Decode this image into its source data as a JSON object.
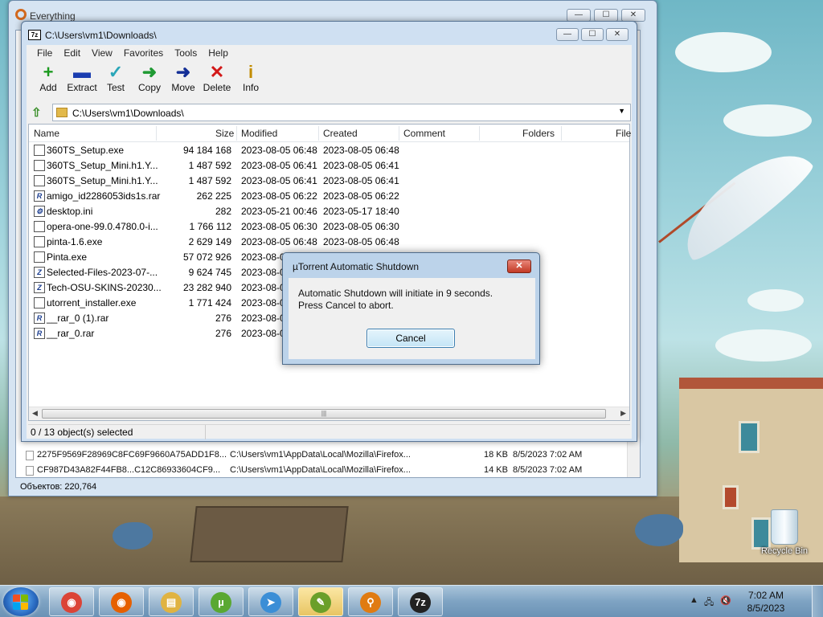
{
  "desktop": {
    "recycle_bin_label": "Recycle Bin"
  },
  "everything": {
    "title": "Everything",
    "controls": [
      "—",
      "☐",
      "✕"
    ],
    "rows": [
      {
        "name": "2275F9569F28969C8FC69F9660A75ADD1F8...",
        "path": "C:\\Users\\vm1\\AppData\\Local\\Mozilla\\Firefox...",
        "size": "18 KB",
        "date": "8/5/2023 7:02 AM"
      },
      {
        "name": "CF987D43A82F44FB8...C12C86933604CF9...",
        "path": "C:\\Users\\vm1\\AppData\\Local\\Mozilla\\Firefox...",
        "size": "14 KB",
        "date": "8/5/2023 7:02 AM"
      }
    ],
    "status": "Объектов: 220,764"
  },
  "sevenzip": {
    "title": "C:\\Users\\vm1\\Downloads\\",
    "controls": [
      "—",
      "☐",
      "✕"
    ],
    "menu": [
      "File",
      "Edit",
      "View",
      "Favorites",
      "Tools",
      "Help"
    ],
    "toolbar": [
      {
        "label": "Add",
        "glyph": "+",
        "color": "#1c9a20",
        "name": "add-button"
      },
      {
        "label": "Extract",
        "glyph": "▬",
        "color": "#1a3db0",
        "name": "extract-button"
      },
      {
        "label": "Test",
        "glyph": "✓",
        "color": "#2aa6b8",
        "name": "test-button"
      },
      {
        "label": "Copy",
        "glyph": "➜",
        "color": "#1f9a33",
        "name": "copy-button"
      },
      {
        "label": "Move",
        "glyph": "➜",
        "color": "#132e96",
        "name": "move-button"
      },
      {
        "label": "Delete",
        "glyph": "✕",
        "color": "#d21818",
        "name": "delete-button"
      },
      {
        "label": "Info",
        "glyph": "i",
        "color": "#c28c00",
        "name": "info-button"
      }
    ],
    "address": "C:\\Users\\vm1\\Downloads\\",
    "columns": [
      "Name",
      "Size",
      "Modified",
      "Created",
      "Comment",
      "Folders",
      "File"
    ],
    "files": [
      {
        "name": "360TS_Setup.exe",
        "size": "94 184 168",
        "modified": "2023-08-05 06:48",
        "created": "2023-08-05 06:48",
        "icon": ""
      },
      {
        "name": "360TS_Setup_Mini.h1.Y...",
        "size": "1 487 592",
        "modified": "2023-08-05 06:41",
        "created": "2023-08-05 06:41",
        "icon": ""
      },
      {
        "name": "360TS_Setup_Mini.h1.Y...",
        "size": "1 487 592",
        "modified": "2023-08-05 06:41",
        "created": "2023-08-05 06:41",
        "icon": ""
      },
      {
        "name": "amigo_id2286053ids1s.rar",
        "size": "262 225",
        "modified": "2023-08-05 06:22",
        "created": "2023-08-05 06:22",
        "icon": "R"
      },
      {
        "name": "desktop.ini",
        "size": "282",
        "modified": "2023-05-21 00:46",
        "created": "2023-05-17 18:40",
        "icon": "⚙"
      },
      {
        "name": "opera-one-99.0.4780.0-i...",
        "size": "1 766 112",
        "modified": "2023-08-05 06:30",
        "created": "2023-08-05 06:30",
        "icon": ""
      },
      {
        "name": "pinta-1.6.exe",
        "size": "2 629 149",
        "modified": "2023-08-05 06:48",
        "created": "2023-08-05 06:48",
        "icon": ""
      },
      {
        "name": "Pinta.exe",
        "size": "57 072 926",
        "modified": "2023-08-0",
        "created": "",
        "icon": ""
      },
      {
        "name": "Selected-Files-2023-07-...",
        "size": "9 624 745",
        "modified": "2023-08-0",
        "created": "",
        "icon": "Z"
      },
      {
        "name": "Tech-OSU-SKINS-20230...",
        "size": "23 282 940",
        "modified": "2023-08-0",
        "created": "",
        "icon": "Z"
      },
      {
        "name": "utorrent_installer.exe",
        "size": "1 771 424",
        "modified": "2023-08-0",
        "created": "",
        "icon": ""
      },
      {
        "name": "__rar_0 (1).rar",
        "size": "276",
        "modified": "2023-08-0",
        "created": "",
        "icon": "R"
      },
      {
        "name": "__rar_0.rar",
        "size": "276",
        "modified": "2023-08-0",
        "created": "",
        "icon": "R"
      }
    ],
    "status": "0 / 13 object(s) selected"
  },
  "dialog": {
    "title": "µTorrent Automatic Shutdown",
    "line1": "Automatic Shutdown will initiate in 9 seconds.",
    "line2": "Press Cancel to abort.",
    "cancel": "Cancel"
  },
  "taskbar": {
    "apps": [
      {
        "name": "chrome-taskbar-button",
        "glyph": "◉",
        "color": "#db4437",
        "active": false
      },
      {
        "name": "firefox-taskbar-button",
        "glyph": "◉",
        "color": "#e66000",
        "active": false
      },
      {
        "name": "explorer-taskbar-button",
        "glyph": "▤",
        "color": "#e0b342",
        "active": false
      },
      {
        "name": "utorrent-taskbar-button",
        "glyph": "µ",
        "color": "#5aa832",
        "active": false
      },
      {
        "name": "mail-taskbar-button",
        "glyph": "➤",
        "color": "#3b8ed6",
        "active": false
      },
      {
        "name": "notepad-taskbar-button",
        "glyph": "✎",
        "color": "#6a9f2a",
        "active": true
      },
      {
        "name": "everything-taskbar-button",
        "glyph": "⚲",
        "color": "#e07b12",
        "active": false
      },
      {
        "name": "7zip-taskbar-button",
        "glyph": "7z",
        "color": "#222222",
        "active": false
      }
    ],
    "time": "7:02 AM",
    "date": "8/5/2023"
  }
}
